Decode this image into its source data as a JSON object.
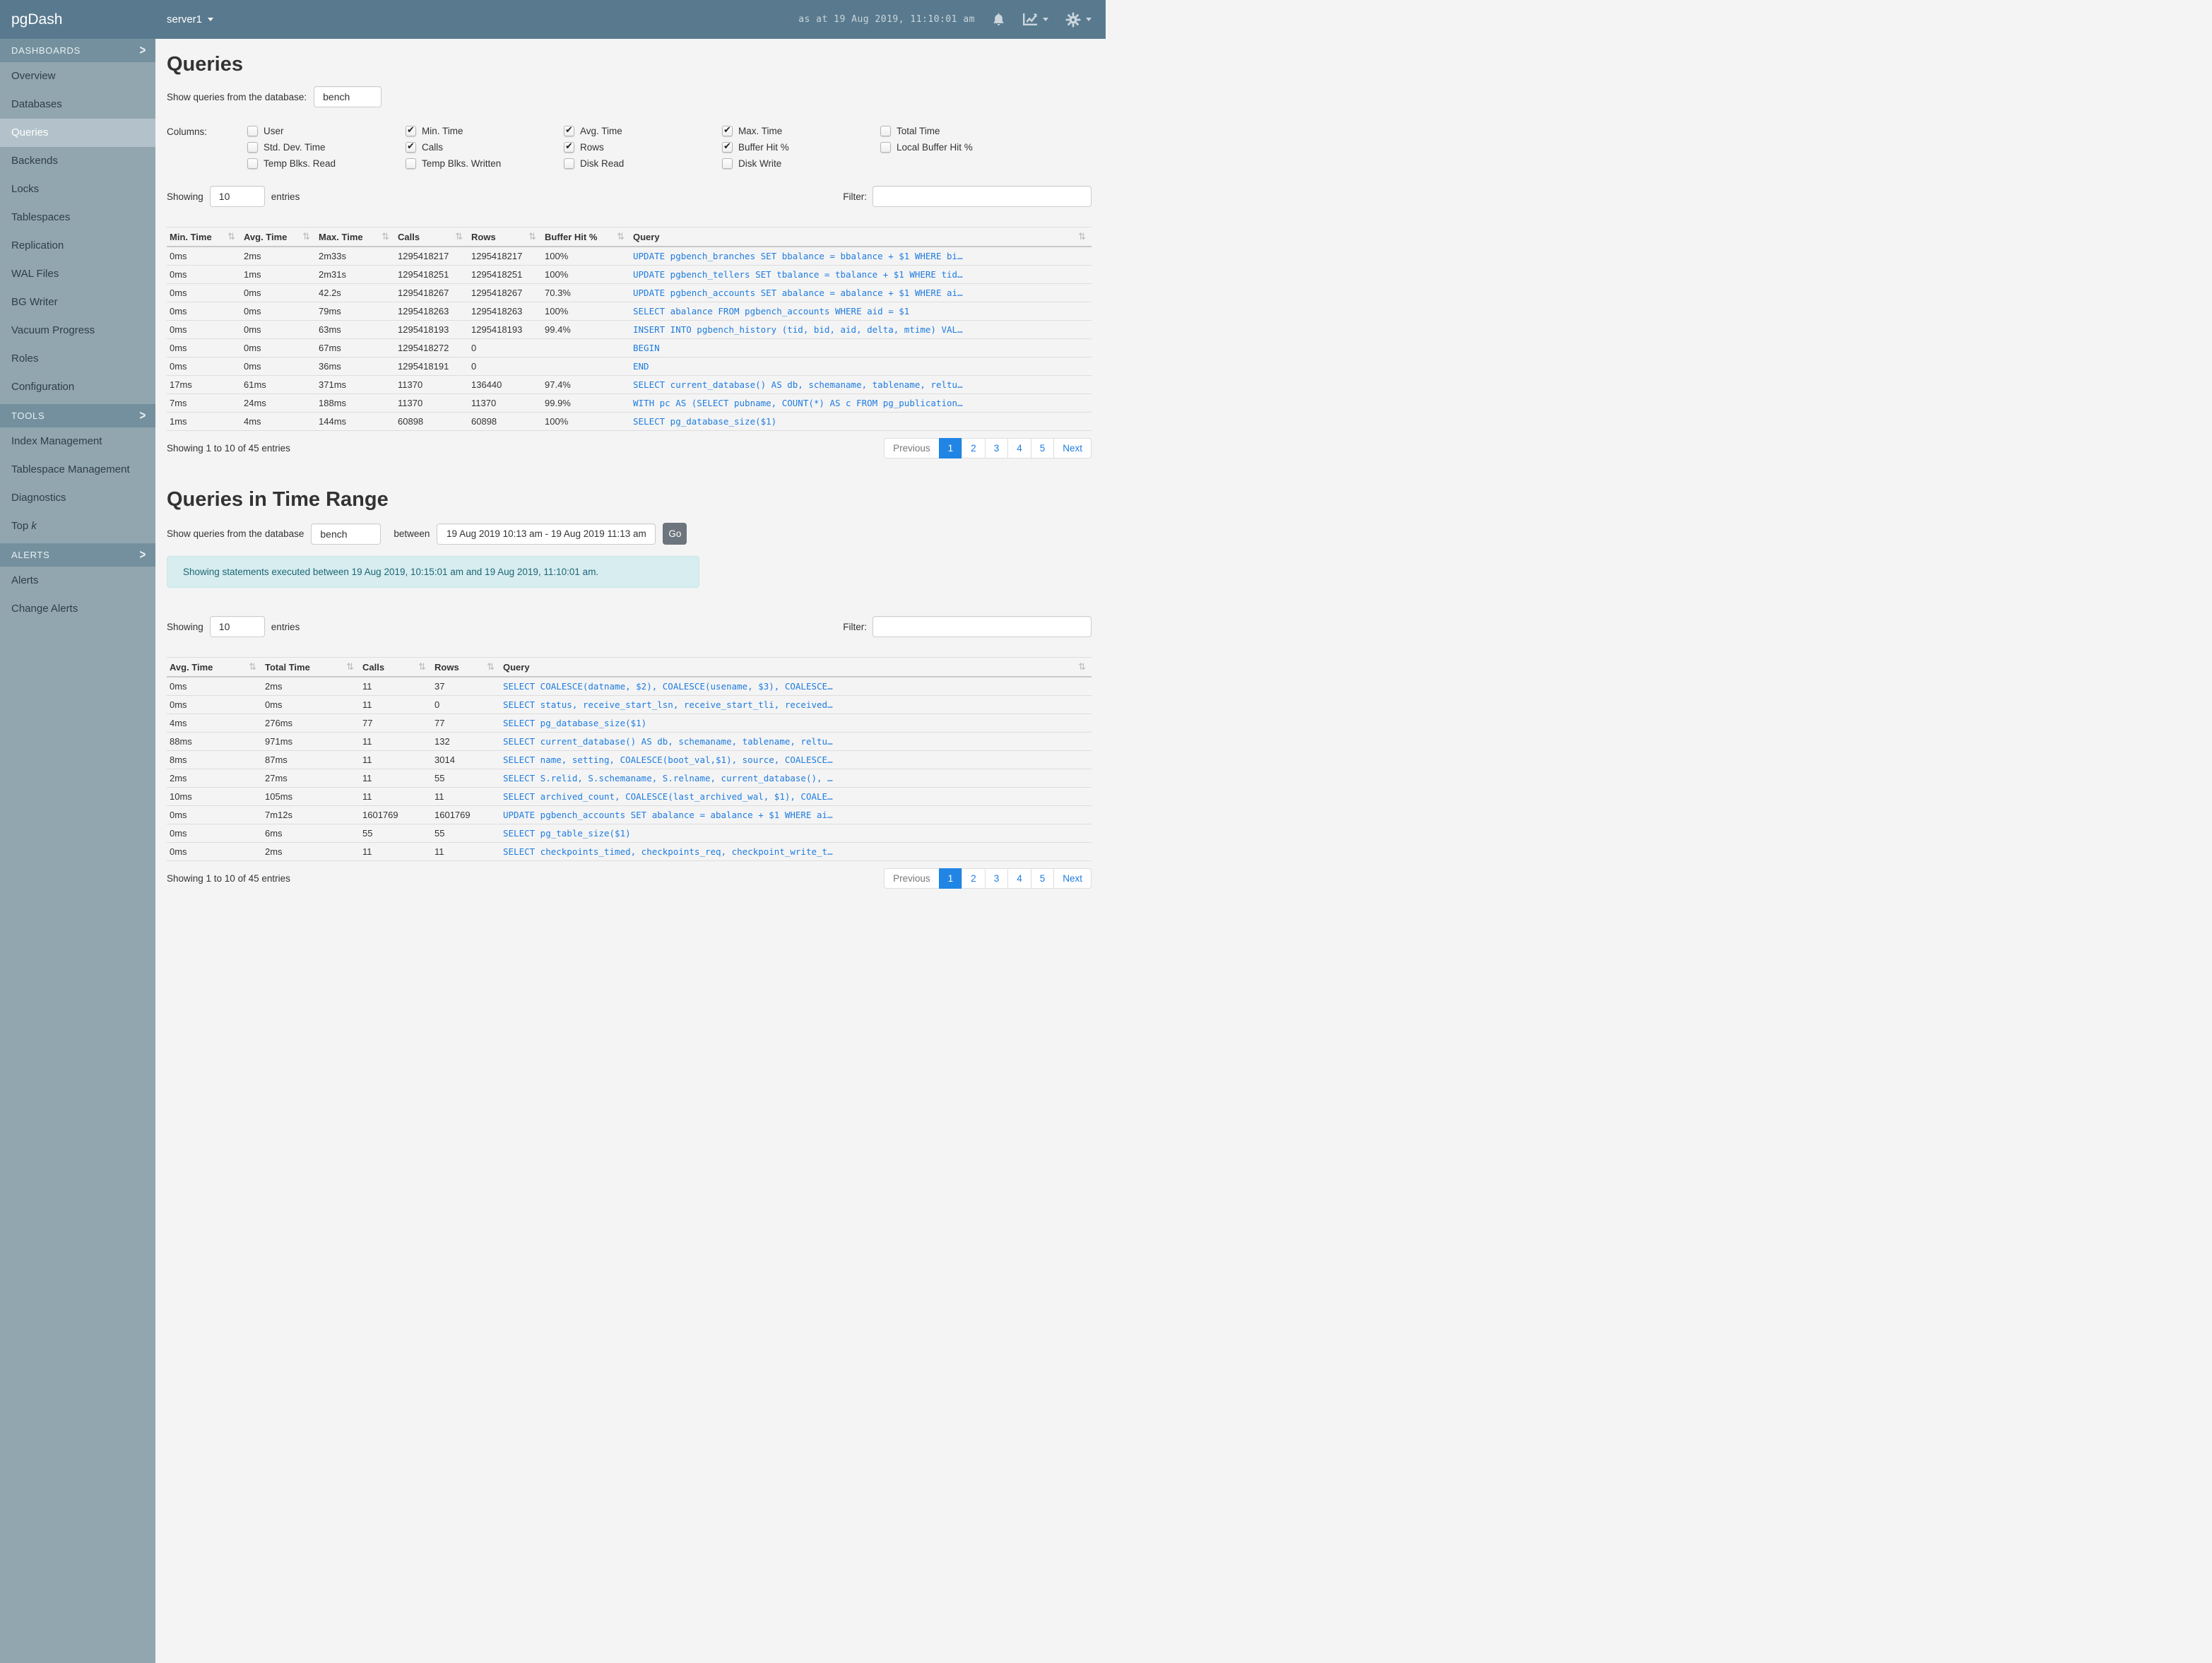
{
  "navbar": {
    "brand": "pgDash",
    "server": "server1",
    "timestamp": "as at 19 Aug 2019, 11:10:01 am"
  },
  "icons": {
    "sort_glyph": "⇅",
    "chevron_glyph": ">",
    "bell": "bell-icon",
    "chart": "chart-icon",
    "gear": "gear-icon"
  },
  "sidebar": {
    "sections": [
      {
        "label": "DASHBOARDS",
        "items": [
          {
            "label": "Overview"
          },
          {
            "label": "Databases"
          },
          {
            "label": "Queries",
            "selected": true
          },
          {
            "label": "Backends"
          },
          {
            "label": "Locks"
          },
          {
            "label": "Tablespaces"
          },
          {
            "label": "Replication"
          },
          {
            "label": "WAL Files"
          },
          {
            "label": "BG Writer"
          },
          {
            "label": "Vacuum Progress"
          },
          {
            "label": "Roles"
          },
          {
            "label": "Configuration"
          }
        ]
      },
      {
        "label": "TOOLS",
        "items": [
          {
            "label": "Index Management"
          },
          {
            "label": "Tablespace Management"
          },
          {
            "label": "Diagnostics"
          },
          {
            "label": "Top k",
            "prefix": "Top ",
            "italic_suffix": "k"
          }
        ]
      },
      {
        "label": "ALERTS",
        "items": [
          {
            "label": "Alerts"
          },
          {
            "label": "Change Alerts"
          }
        ]
      }
    ]
  },
  "queries_section": {
    "title": "Queries",
    "db_label": "Show queries from the database:",
    "db_value": "bench",
    "columns_label": "Columns:",
    "column_groups": [
      [
        {
          "label": "User",
          "checked": false
        },
        {
          "label": "Std. Dev. Time",
          "checked": false
        },
        {
          "label": "Temp Blks. Read",
          "checked": false
        }
      ],
      [
        {
          "label": "Min. Time",
          "checked": true
        },
        {
          "label": "Calls",
          "checked": true
        },
        {
          "label": "Temp Blks. Written",
          "checked": false
        }
      ],
      [
        {
          "label": "Avg. Time",
          "checked": true
        },
        {
          "label": "Rows",
          "checked": true
        },
        {
          "label": "Disk Read",
          "checked": false
        }
      ],
      [
        {
          "label": "Max. Time",
          "checked": true
        },
        {
          "label": "Buffer Hit %",
          "checked": true
        },
        {
          "label": "Disk Write",
          "checked": false
        }
      ],
      [
        {
          "label": "Total Time",
          "checked": false
        },
        {
          "label": "Local Buffer Hit %",
          "checked": false
        }
      ]
    ]
  },
  "entries_bar": {
    "showing": "Showing",
    "value": "10",
    "entries": "entries",
    "filter": "Filter:"
  },
  "table1": {
    "headers": [
      "Min. Time",
      "Avg. Time",
      "Max. Time",
      "Calls",
      "Rows",
      "Buffer Hit %",
      "Query"
    ],
    "rows": [
      {
        "min_time": "0ms",
        "avg_time": "2ms",
        "max_time": "2m33s",
        "calls": "1295418217",
        "rows": "1295418217",
        "buffer_hit": "100%",
        "query": "UPDATE pgbench_branches SET bbalance = bbalance + $1 WHERE bi…"
      },
      {
        "min_time": "0ms",
        "avg_time": "1ms",
        "max_time": "2m31s",
        "calls": "1295418251",
        "rows": "1295418251",
        "buffer_hit": "100%",
        "query": "UPDATE pgbench_tellers SET tbalance = tbalance + $1 WHERE tid…"
      },
      {
        "min_time": "0ms",
        "avg_time": "0ms",
        "max_time": "42.2s",
        "calls": "1295418267",
        "rows": "1295418267",
        "buffer_hit": "70.3%",
        "query": "UPDATE pgbench_accounts SET abalance = abalance + $1 WHERE ai…"
      },
      {
        "min_time": "0ms",
        "avg_time": "0ms",
        "max_time": "79ms",
        "calls": "1295418263",
        "rows": "1295418263",
        "buffer_hit": "100%",
        "query": "SELECT abalance FROM pgbench_accounts WHERE aid = $1"
      },
      {
        "min_time": "0ms",
        "avg_time": "0ms",
        "max_time": "63ms",
        "calls": "1295418193",
        "rows": "1295418193",
        "buffer_hit": "99.4%",
        "query": "INSERT INTO pgbench_history (tid, bid, aid, delta, mtime) VAL…"
      },
      {
        "min_time": "0ms",
        "avg_time": "0ms",
        "max_time": "67ms",
        "calls": "1295418272",
        "rows": "0",
        "buffer_hit": "",
        "query": "BEGIN"
      },
      {
        "min_time": "0ms",
        "avg_time": "0ms",
        "max_time": "36ms",
        "calls": "1295418191",
        "rows": "0",
        "buffer_hit": "",
        "query": "END"
      },
      {
        "min_time": "17ms",
        "avg_time": "61ms",
        "max_time": "371ms",
        "calls": "11370",
        "rows": "136440",
        "buffer_hit": "97.4%",
        "query": "SELECT current_database() AS db, schemaname, tablename, reltu…"
      },
      {
        "min_time": "7ms",
        "avg_time": "24ms",
        "max_time": "188ms",
        "calls": "11370",
        "rows": "11370",
        "buffer_hit": "99.9%",
        "query": "WITH pc AS (SELECT pubname, COUNT(*) AS c FROM pg_publication…"
      },
      {
        "min_time": "1ms",
        "avg_time": "4ms",
        "max_time": "144ms",
        "calls": "60898",
        "rows": "60898",
        "buffer_hit": "100%",
        "query": "SELECT pg_database_size($1)"
      }
    ],
    "footer": "Showing 1 to 10 of 45 entries"
  },
  "pagination": {
    "previous": "Previous",
    "pages": [
      "1",
      "2",
      "3",
      "4",
      "5"
    ],
    "active": "1",
    "next": "Next"
  },
  "time_range_section": {
    "title": "Queries in Time Range",
    "db_label": "Show queries from the database",
    "db_value": "bench",
    "between": "between",
    "range_value": "19 Aug 2019 10:13 am - 19 Aug 2019 11:13 am",
    "go": "Go",
    "notice": "Showing statements executed between 19 Aug 2019, 10:15:01 am and 19 Aug 2019, 11:10:01 am."
  },
  "table2": {
    "headers": [
      "Avg. Time",
      "Total Time",
      "Calls",
      "Rows",
      "Query"
    ],
    "rows": [
      {
        "avg_time": "0ms",
        "total_time": "2ms",
        "calls": "11",
        "rows": "37",
        "query": "SELECT COALESCE(datname, $2), COALESCE(usename, $3), COALESCE…"
      },
      {
        "avg_time": "0ms",
        "total_time": "0ms",
        "calls": "11",
        "rows": "0",
        "query": "SELECT status, receive_start_lsn, receive_start_tli, received…"
      },
      {
        "avg_time": "4ms",
        "total_time": "276ms",
        "calls": "77",
        "rows": "77",
        "query": "SELECT pg_database_size($1)"
      },
      {
        "avg_time": "88ms",
        "total_time": "971ms",
        "calls": "11",
        "rows": "132",
        "query": "SELECT current_database() AS db, schemaname, tablename, reltu…"
      },
      {
        "avg_time": "8ms",
        "total_time": "87ms",
        "calls": "11",
        "rows": "3014",
        "query": "SELECT name, setting, COALESCE(boot_val,$1), source, COALESCE…"
      },
      {
        "avg_time": "2ms",
        "total_time": "27ms",
        "calls": "11",
        "rows": "55",
        "query": "SELECT S.relid, S.schemaname, S.relname, current_database(), …"
      },
      {
        "avg_time": "10ms",
        "total_time": "105ms",
        "calls": "11",
        "rows": "11",
        "query": "SELECT archived_count, COALESCE(last_archived_wal, $1), COALE…"
      },
      {
        "avg_time": "0ms",
        "total_time": "7m12s",
        "calls": "1601769",
        "rows": "1601769",
        "query": "UPDATE pgbench_accounts SET abalance = abalance + $1 WHERE ai…"
      },
      {
        "avg_time": "0ms",
        "total_time": "6ms",
        "calls": "55",
        "rows": "55",
        "query": "SELECT pg_table_size($1)"
      },
      {
        "avg_time": "0ms",
        "total_time": "2ms",
        "calls": "11",
        "rows": "11",
        "query": "SELECT checkpoints_timed, checkpoints_req, checkpoint_write_t…"
      }
    ],
    "footer": "Showing 1 to 10 of 45 entries"
  },
  "colors": {
    "navbar_bg": "#597a8e",
    "section_header_bg": "#74909e",
    "sidebar_bg": "#92a6b0",
    "selected_item_bg": "#b3c2ca",
    "link_blue": "#1f7ce0",
    "active_page_bg": "#2185e5",
    "alert_bg": "#d7edf0",
    "alert_text": "#1d6673",
    "go_button_bg": "#6c757d"
  }
}
